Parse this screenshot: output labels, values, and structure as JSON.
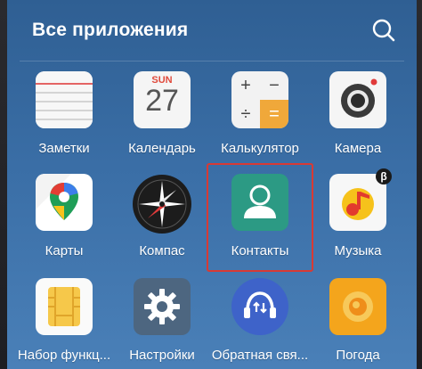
{
  "header": {
    "title": "Все приложения",
    "search_icon": "search-icon"
  },
  "apps": [
    {
      "label": "Заметки",
      "icon": "notes-icon"
    },
    {
      "label": "Календарь",
      "icon": "calendar-icon",
      "calendar_month": "SUN",
      "calendar_day": "27"
    },
    {
      "label": "Калькулятор",
      "icon": "calculator-icon",
      "keys": [
        "+",
        "−",
        "÷",
        "="
      ]
    },
    {
      "label": "Камера",
      "icon": "camera-icon"
    },
    {
      "label": "Карты",
      "icon": "maps-icon"
    },
    {
      "label": "Компас",
      "icon": "compass-icon"
    },
    {
      "label": "Контакты",
      "icon": "contacts-icon"
    },
    {
      "label": "Музыка",
      "icon": "music-icon",
      "badge": "β"
    },
    {
      "label": "Набор функц...",
      "icon": "sim-toolkit-icon"
    },
    {
      "label": "Настройки",
      "icon": "settings-icon"
    },
    {
      "label": "Обратная свя...",
      "icon": "feedback-icon"
    },
    {
      "label": "Погода",
      "icon": "weather-icon"
    }
  ],
  "colors": {
    "highlight": "#d83a34",
    "contacts_bg": "#2c9a84",
    "settings_bg": "#4d6680",
    "feedback_bg": "#3e63c9",
    "weather_bg": "#f4a51c"
  }
}
